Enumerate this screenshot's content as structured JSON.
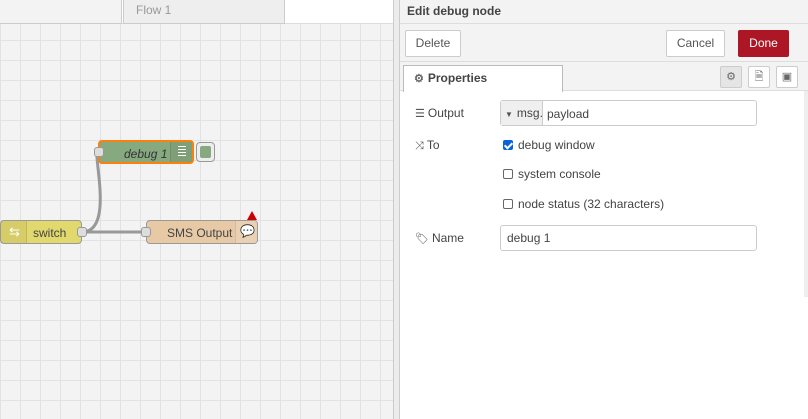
{
  "workspace": {
    "tabs": [
      {
        "label": "Flow 1"
      }
    ],
    "nodes": {
      "debug": {
        "label": "debug 1"
      },
      "switch": {
        "label": "switch"
      },
      "sms": {
        "label": "SMS Output"
      }
    }
  },
  "tray": {
    "title": "Edit debug node",
    "buttons": {
      "delete": "Delete",
      "cancel": "Cancel",
      "done": "Done"
    },
    "tabs": [
      {
        "label": "Properties"
      }
    ],
    "form": {
      "output": {
        "label": "Output",
        "type": "msg.",
        "value": "payload"
      },
      "to": {
        "label": "To",
        "options": [
          {
            "label": "debug window",
            "checked": true
          },
          {
            "label": "system console",
            "checked": false
          },
          {
            "label": "node status (32 characters)",
            "checked": false
          }
        ]
      },
      "name": {
        "label": "Name",
        "value": "debug 1"
      }
    }
  },
  "colors": {
    "done": "#ad1625",
    "debug_node": "#87a980",
    "switch_node": "#e2d96e",
    "sms_node": "#e7c9a6",
    "selected": "#ff7f0e",
    "warning": "#cc0000"
  }
}
